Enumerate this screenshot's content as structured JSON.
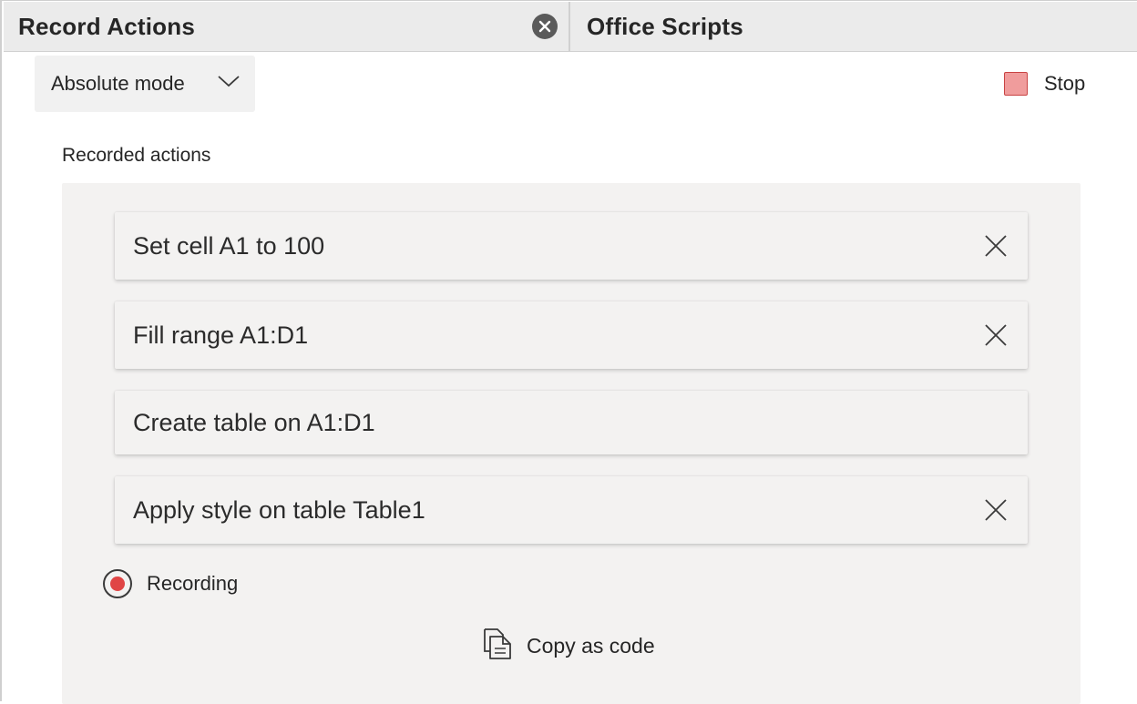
{
  "tabs": [
    {
      "label": "Record Actions",
      "active": true
    },
    {
      "label": "Office Scripts",
      "active": false
    }
  ],
  "toolbar": {
    "mode_label": "Absolute mode",
    "stop_label": "Stop"
  },
  "section": {
    "title": "Recorded actions"
  },
  "actions": [
    {
      "label": "Set cell A1 to 100",
      "removable": true
    },
    {
      "label": "Fill range A1:D1",
      "removable": true
    },
    {
      "label": "Create table on A1:D1",
      "removable": false
    },
    {
      "label": "Apply style on table Table1",
      "removable": true
    }
  ],
  "status": {
    "recording_label": "Recording"
  },
  "copy": {
    "label": "Copy as code"
  },
  "colors": {
    "stop_fill": "#f09c9c",
    "stop_border": "#c84343",
    "recording_dot": "#e04545",
    "panel_bg": "#f3f2f1"
  },
  "icons": {
    "tab_close": "close-circle-icon",
    "dropdown": "chevron-down-icon",
    "stop": "stop-square-icon",
    "remove": "close-icon",
    "recording": "record-icon",
    "copy": "copy-document-icon"
  }
}
